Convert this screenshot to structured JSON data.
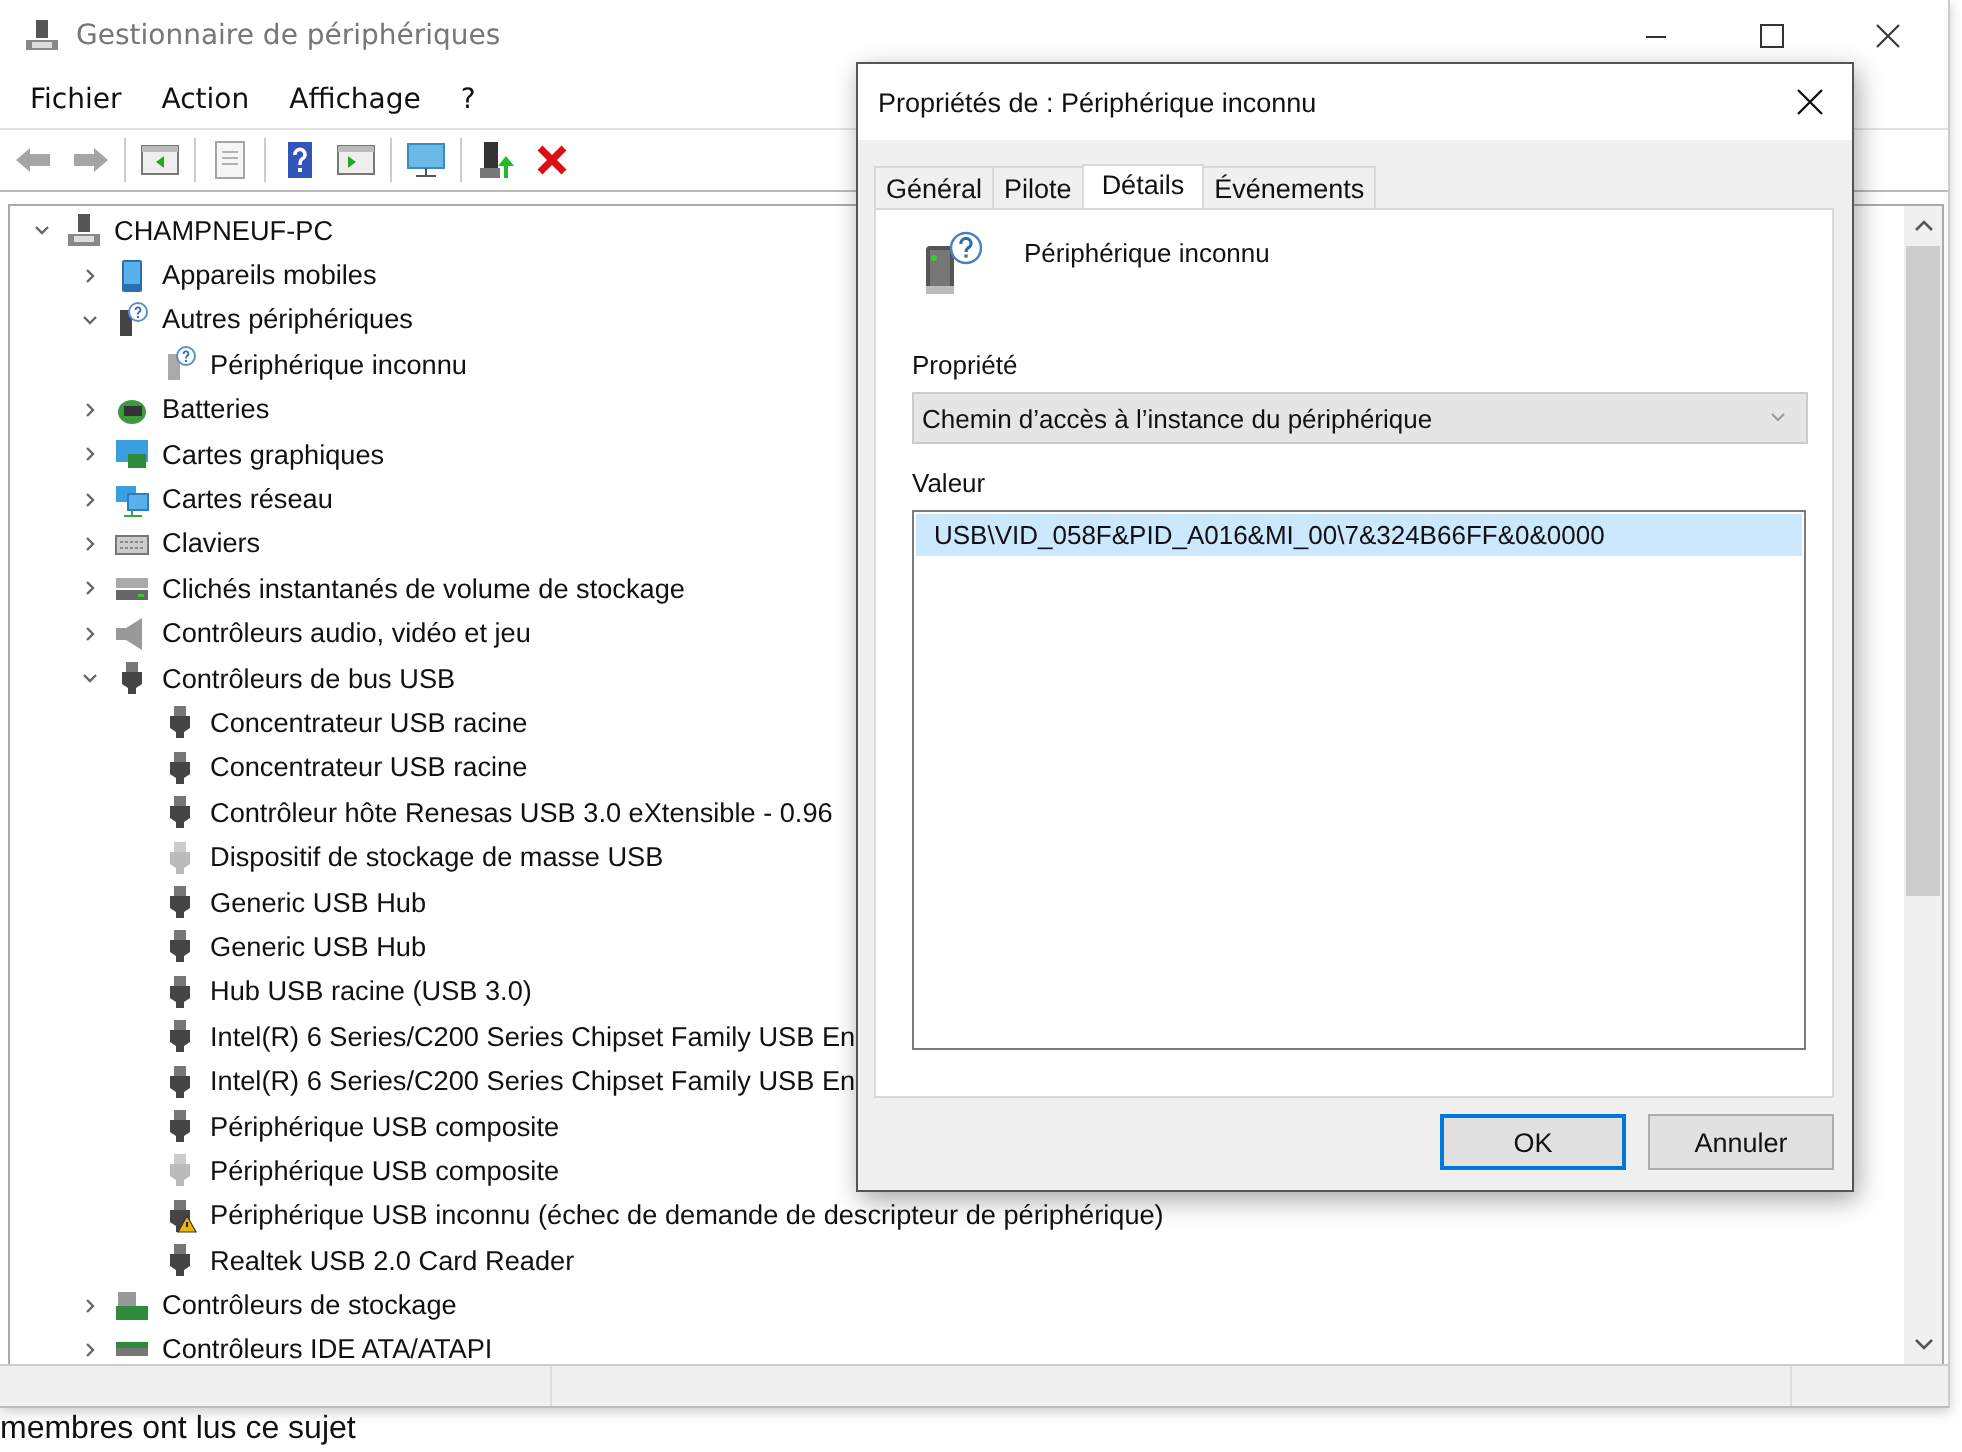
{
  "window": {
    "title": "Gestionnaire de périphériques"
  },
  "menu": [
    "Fichier",
    "Action",
    "Affichage",
    "?"
  ],
  "toolbar": [
    {
      "kind": "back",
      "disabled": true
    },
    {
      "kind": "forward",
      "disabled": true
    },
    {
      "kind": "separator"
    },
    {
      "kind": "tree-pane",
      "disabled": false
    },
    {
      "kind": "separator"
    },
    {
      "kind": "properties",
      "disabled": true
    },
    {
      "kind": "separator"
    },
    {
      "kind": "help",
      "disabled": false
    },
    {
      "kind": "action-pane",
      "disabled": false
    },
    {
      "kind": "separator"
    },
    {
      "kind": "scan",
      "disabled": false
    },
    {
      "kind": "separator"
    },
    {
      "kind": "update",
      "disabled": false
    },
    {
      "kind": "uninstall",
      "disabled": false
    }
  ],
  "tree": [
    {
      "label": "CHAMPNEUF-PC",
      "kind": "computer",
      "expanded": true,
      "children": [
        {
          "label": "Appareils mobiles",
          "kind": "mobile",
          "expanded": false
        },
        {
          "label": "Autres périphériques",
          "kind": "unknown",
          "expanded": true,
          "children": [
            {
              "label": "Périphérique inconnu",
              "kind": "unknown-device"
            }
          ]
        },
        {
          "label": "Batteries",
          "kind": "battery",
          "expanded": false
        },
        {
          "label": "Cartes graphiques",
          "kind": "display",
          "expanded": false
        },
        {
          "label": "Cartes réseau",
          "kind": "network",
          "expanded": false
        },
        {
          "label": "Claviers",
          "kind": "keyboard",
          "expanded": false
        },
        {
          "label": "Clichés instantanés de volume de stockage",
          "kind": "disk",
          "expanded": false
        },
        {
          "label": "Contrôleurs audio, vidéo et jeu",
          "kind": "speaker",
          "expanded": false
        },
        {
          "label": "Contrôleurs de bus USB",
          "kind": "usb",
          "expanded": true,
          "children": [
            {
              "label": "Concentrateur USB racine",
              "hidden": false,
              "warning": false
            },
            {
              "label": "Concentrateur USB racine",
              "hidden": false,
              "warning": false
            },
            {
              "label": "Contrôleur hôte Renesas USB 3.0 eXtensible - 0.96",
              "hidden": false,
              "warning": false
            },
            {
              "label": "Dispositif de stockage de masse USB",
              "hidden": true,
              "warning": false
            },
            {
              "label": "Generic USB Hub",
              "hidden": false,
              "warning": false
            },
            {
              "label": "Generic USB Hub",
              "hidden": false,
              "warning": false
            },
            {
              "label": "Hub USB racine (USB 3.0)",
              "hidden": false,
              "warning": false
            },
            {
              "label": "Intel(R) 6 Series/C200 Series Chipset Family USB En",
              "hidden": false,
              "warning": false
            },
            {
              "label": "Intel(R) 6 Series/C200 Series Chipset Family USB En",
              "hidden": false,
              "warning": false
            },
            {
              "label": "Périphérique USB composite",
              "hidden": false,
              "warning": false
            },
            {
              "label": "Périphérique USB composite",
              "hidden": true,
              "warning": false
            },
            {
              "label": "Périphérique USB inconnu (échec de demande de descripteur de périphérique)",
              "hidden": false,
              "warning": true
            },
            {
              "label": "Realtek USB 2.0 Card Reader",
              "hidden": false,
              "warning": false
            }
          ]
        },
        {
          "label": "Contrôleurs de stockage",
          "kind": "storage",
          "expanded": false
        },
        {
          "label": "Contrôleurs IDE ATA/ATAPI",
          "kind": "ide",
          "expanded": false
        }
      ]
    }
  ],
  "dialog": {
    "title": "Propriétés de : Périphérique inconnu",
    "tabs": [
      {
        "label": "Général",
        "selected": false
      },
      {
        "label": "Pilote",
        "selected": false
      },
      {
        "label": "Détails",
        "selected": true
      },
      {
        "label": "Événements",
        "selected": false
      }
    ],
    "device_name": "Périphérique inconnu",
    "property_label": "Propriété",
    "property_value": "Chemin d’accès à l’instance du périphérique",
    "value_label": "Valeur",
    "values": [
      {
        "text": "USB\\VID_058F&PID_A016&MI_00\\7&324B66FF&0&0000",
        "selected": true
      }
    ],
    "buttons": [
      {
        "label": "OK",
        "default": true
      },
      {
        "label": "Annuler",
        "default": false
      }
    ]
  },
  "background_text": "membres ont lus ce sujet"
}
